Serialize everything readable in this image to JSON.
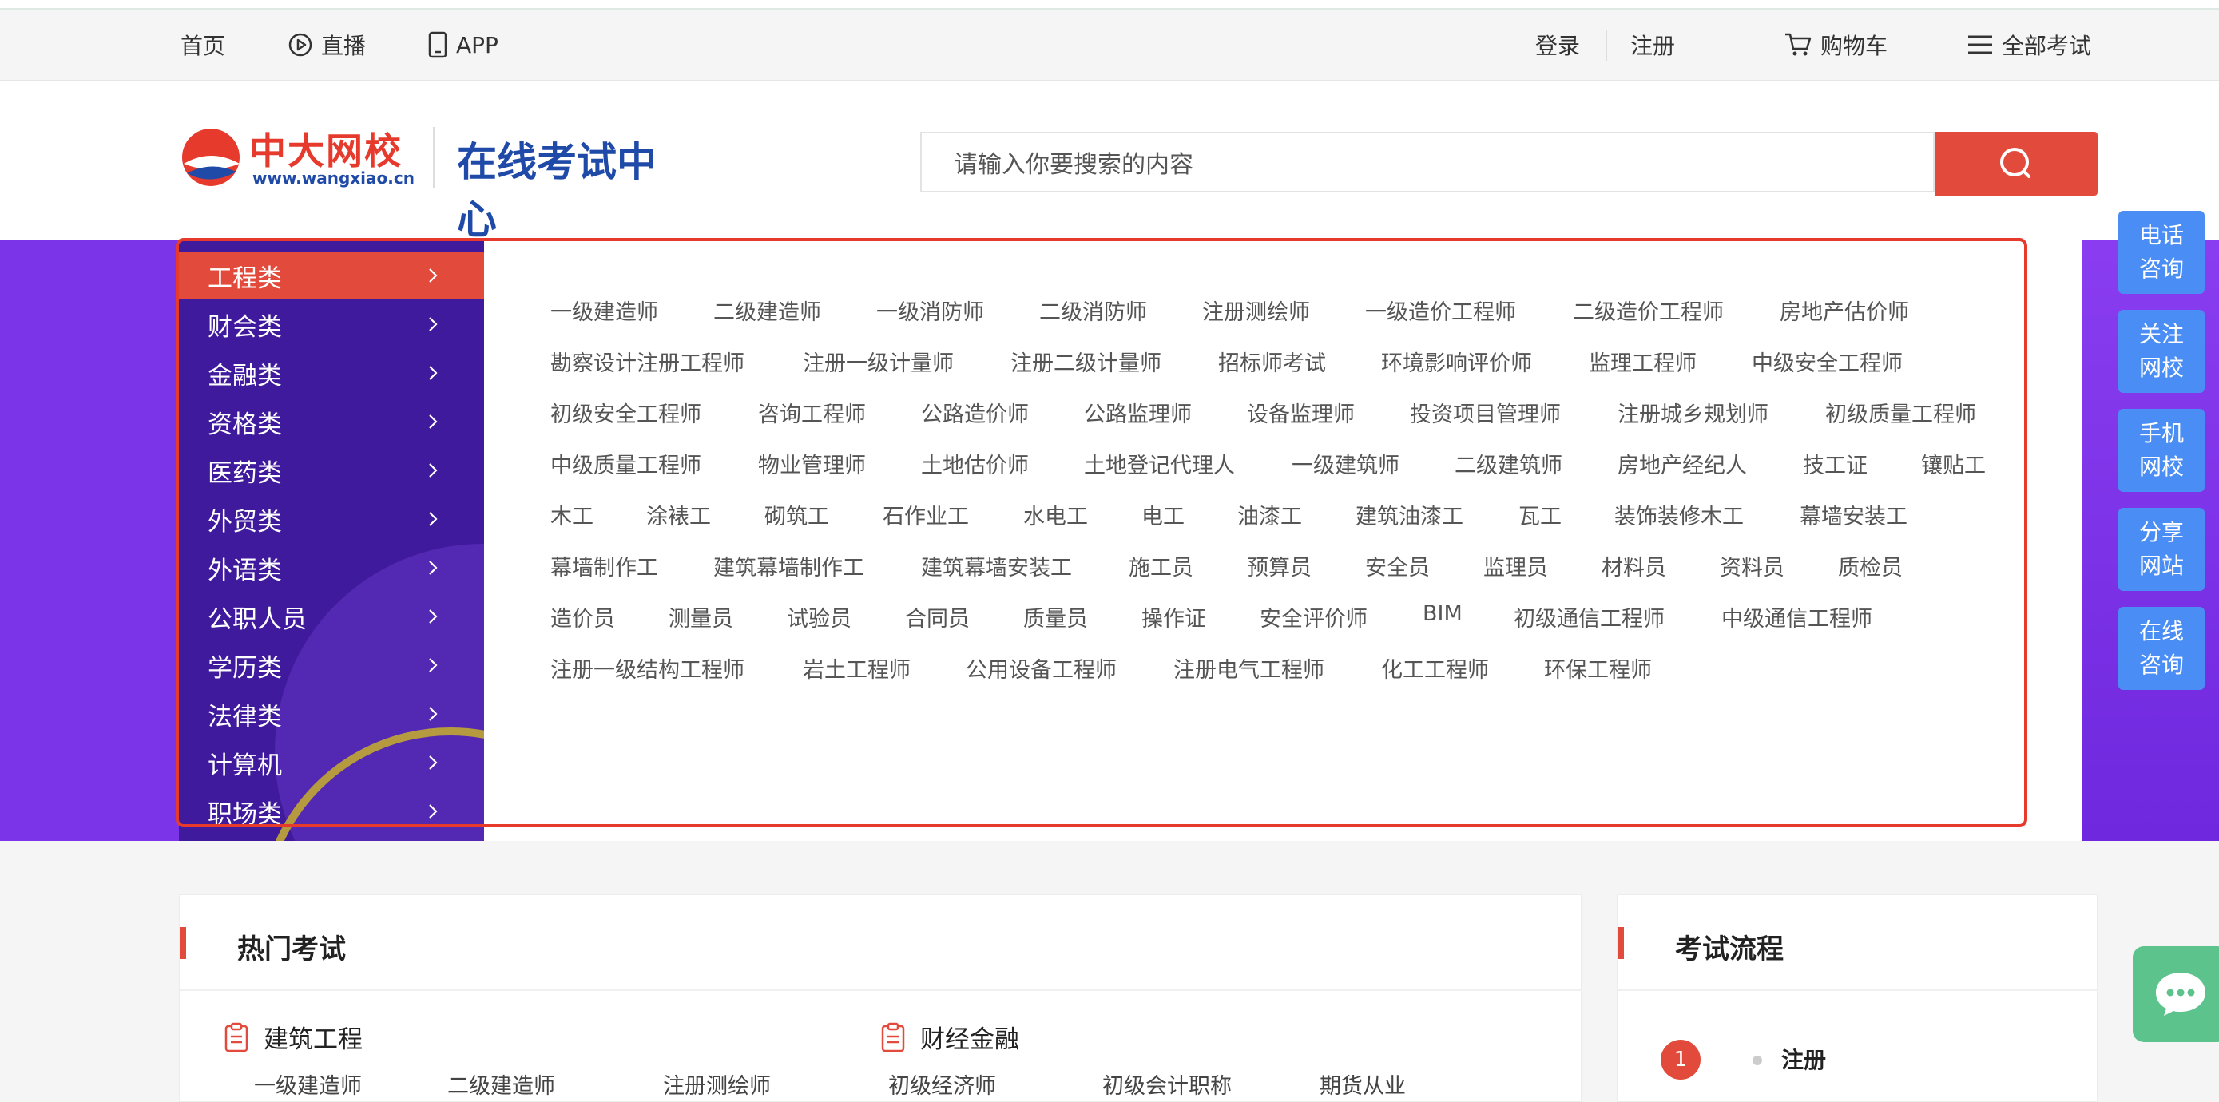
{
  "topbar": {
    "home": "首页",
    "live": "直播",
    "app": "APP",
    "login": "登录",
    "register": "注册",
    "cart": "购物车",
    "all_exams": "全部考试"
  },
  "header": {
    "logo_text": "中大网校",
    "logo_url": "www.wangxiao.cn",
    "logo_subtitle": "在线考试中心",
    "search_placeholder": "请输入你要搜索的内容"
  },
  "categories": [
    "工程类",
    "财会类",
    "金融类",
    "资格类",
    "医药类",
    "外贸类",
    "外语类",
    "公职人员",
    "学历类",
    "法律类",
    "计算机",
    "职场类"
  ],
  "active_category": "工程类",
  "exam_rows": [
    [
      "一级建造师",
      "二级建造师",
      "一级消防师",
      "二级消防师",
      "注册测绘师",
      "一级造价工程师",
      "二级造价工程师",
      "房地产估价师"
    ],
    [
      "勘察设计注册工程师",
      "注册一级计量师",
      "注册二级计量师",
      "招标师考试",
      "环境影响评价师",
      "监理工程师",
      "中级安全工程师"
    ],
    [
      "初级安全工程师",
      "咨询工程师",
      "公路造价师",
      "公路监理师",
      "设备监理师",
      "投资项目管理师",
      "注册城乡规划师",
      "初级质量工程师"
    ],
    [
      "中级质量工程师",
      "物业管理师",
      "土地估价师",
      "土地登记代理人",
      "一级建筑师",
      "二级建筑师",
      "房地产经纪人",
      "技工证",
      "镶贴工"
    ],
    [
      "木工",
      "涂裱工",
      "砌筑工",
      "石作业工",
      "水电工",
      "电工",
      "油漆工",
      "建筑油漆工",
      "瓦工",
      "装饰装修木工",
      "幕墙安装工"
    ],
    [
      "幕墙制作工",
      "建筑幕墙制作工",
      "建筑幕墙安装工",
      "施工员",
      "预算员",
      "安全员",
      "监理员",
      "材料员",
      "资料员",
      "质检员"
    ],
    [
      "造价员",
      "测量员",
      "试验员",
      "合同员",
      "质量员",
      "操作证",
      "安全评价师",
      "BIM",
      "初级通信工程师",
      "中级通信工程师"
    ],
    [
      "注册一级结构工程师",
      "岩土工程师",
      "公用设备工程师",
      "注册电气工程师",
      "化工工程师",
      "环保工程师"
    ]
  ],
  "right_sidebar": [
    [
      "电话",
      "咨询"
    ],
    [
      "关注",
      "网校"
    ],
    [
      "手机",
      "网校"
    ],
    [
      "分享",
      "网站"
    ],
    [
      "在线",
      "咨询"
    ]
  ],
  "hot_exams": {
    "title": "热门考试",
    "groups": [
      {
        "name": "建筑工程",
        "items": [
          "一级建造师",
          "二级建造师",
          "注册测绘师"
        ]
      },
      {
        "name": "财经金融",
        "items": [
          "初级经济师",
          "初级会计职称",
          "期货从业"
        ]
      }
    ]
  },
  "exam_process": {
    "title": "考试流程",
    "step_number": "1",
    "step_label": "注册"
  },
  "colors": {
    "accent_red": "#e24b3c",
    "banner_purple": "#7b34e8",
    "category_bg": "#3f1a9c",
    "sidebar_blue": "#4a8ef5",
    "chat_green": "#5cc38d"
  }
}
